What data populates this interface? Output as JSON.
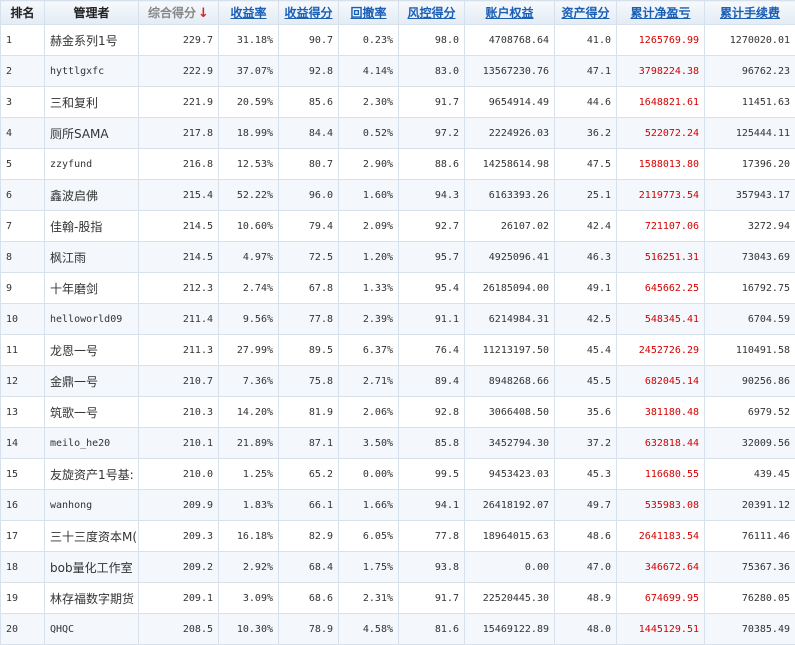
{
  "headers": {
    "rank": "排名",
    "manager": "管理者",
    "total": "综合得分",
    "sort_arrow": "↓",
    "ret": "收益率",
    "ret_score": "收益得分",
    "drawdown": "回撤率",
    "risk": "风控得分",
    "equity": "账户权益",
    "asset_score": "资产得分",
    "pnl": "累计净盈亏",
    "fee": "累计手续费"
  },
  "colors": {
    "link": "#1b5fb5",
    "pnl": "#d40000",
    "sort_arrow": "#e02020"
  },
  "rows": [
    {
      "rank": "1",
      "manager": "赫金系列1号",
      "total": "229.7",
      "ret": "31.18%",
      "ret_score": "90.7",
      "drawdown": "0.23%",
      "risk": "98.0",
      "equity": "4708768.64",
      "asset_score": "41.0",
      "pnl": "1265769.99",
      "fee": "1270020.01"
    },
    {
      "rank": "2",
      "manager": "hyttlgxfc",
      "total": "222.9",
      "ret": "37.07%",
      "ret_score": "92.8",
      "drawdown": "4.14%",
      "risk": "83.0",
      "equity": "13567230.76",
      "asset_score": "47.1",
      "pnl": "3798224.38",
      "fee": "96762.23"
    },
    {
      "rank": "3",
      "manager": "三和复利",
      "total": "221.9",
      "ret": "20.59%",
      "ret_score": "85.6",
      "drawdown": "2.30%",
      "risk": "91.7",
      "equity": "9654914.49",
      "asset_score": "44.6",
      "pnl": "1648821.61",
      "fee": "11451.63"
    },
    {
      "rank": "4",
      "manager": "厕所SAMA",
      "total": "217.8",
      "ret": "18.99%",
      "ret_score": "84.4",
      "drawdown": "0.52%",
      "risk": "97.2",
      "equity": "2224926.03",
      "asset_score": "36.2",
      "pnl": "522072.24",
      "fee": "125444.11"
    },
    {
      "rank": "5",
      "manager": "zzyfund",
      "total": "216.8",
      "ret": "12.53%",
      "ret_score": "80.7",
      "drawdown": "2.90%",
      "risk": "88.6",
      "equity": "14258614.98",
      "asset_score": "47.5",
      "pnl": "1588013.80",
      "fee": "17396.20"
    },
    {
      "rank": "6",
      "manager": "鑫波启佛",
      "total": "215.4",
      "ret": "52.22%",
      "ret_score": "96.0",
      "drawdown": "1.60%",
      "risk": "94.3",
      "equity": "6163393.26",
      "asset_score": "25.1",
      "pnl": "2119773.54",
      "fee": "357943.17"
    },
    {
      "rank": "7",
      "manager": "佳翰-股指",
      "total": "214.5",
      "ret": "10.60%",
      "ret_score": "79.4",
      "drawdown": "2.09%",
      "risk": "92.7",
      "equity": "26107.02",
      "asset_score": "42.4",
      "pnl": "721107.06",
      "fee": "3272.94"
    },
    {
      "rank": "8",
      "manager": "枫江雨",
      "total": "214.5",
      "ret": "4.97%",
      "ret_score": "72.5",
      "drawdown": "1.20%",
      "risk": "95.7",
      "equity": "4925096.41",
      "asset_score": "46.3",
      "pnl": "516251.31",
      "fee": "73043.69"
    },
    {
      "rank": "9",
      "manager": "十年磨剑",
      "total": "212.3",
      "ret": "2.74%",
      "ret_score": "67.8",
      "drawdown": "1.33%",
      "risk": "95.4",
      "equity": "26185094.00",
      "asset_score": "49.1",
      "pnl": "645662.25",
      "fee": "16792.75"
    },
    {
      "rank": "10",
      "manager": "helloworld09",
      "total": "211.4",
      "ret": "9.56%",
      "ret_score": "77.8",
      "drawdown": "2.39%",
      "risk": "91.1",
      "equity": "6214984.31",
      "asset_score": "42.5",
      "pnl": "548345.41",
      "fee": "6704.59"
    },
    {
      "rank": "11",
      "manager": "龙恩一号",
      "total": "211.3",
      "ret": "27.99%",
      "ret_score": "89.5",
      "drawdown": "6.37%",
      "risk": "76.4",
      "equity": "11213197.50",
      "asset_score": "45.4",
      "pnl": "2452726.29",
      "fee": "110491.58"
    },
    {
      "rank": "12",
      "manager": "金鼎一号",
      "total": "210.7",
      "ret": "7.36%",
      "ret_score": "75.8",
      "drawdown": "2.71%",
      "risk": "89.4",
      "equity": "8948268.66",
      "asset_score": "45.5",
      "pnl": "682045.14",
      "fee": "90256.86"
    },
    {
      "rank": "13",
      "manager": "筑歌一号",
      "total": "210.3",
      "ret": "14.20%",
      "ret_score": "81.9",
      "drawdown": "2.06%",
      "risk": "92.8",
      "equity": "3066408.50",
      "asset_score": "35.6",
      "pnl": "381180.48",
      "fee": "6979.52"
    },
    {
      "rank": "14",
      "manager": "meilo_he20",
      "total": "210.1",
      "ret": "21.89%",
      "ret_score": "87.1",
      "drawdown": "3.50%",
      "risk": "85.8",
      "equity": "3452794.30",
      "asset_score": "37.2",
      "pnl": "632818.44",
      "fee": "32009.56"
    },
    {
      "rank": "15",
      "manager": "友旋资产1号基:",
      "total": "210.0",
      "ret": "1.25%",
      "ret_score": "65.2",
      "drawdown": "0.00%",
      "risk": "99.5",
      "equity": "9453423.03",
      "asset_score": "45.3",
      "pnl": "116680.55",
      "fee": "439.45"
    },
    {
      "rank": "16",
      "manager": "wanhong",
      "total": "209.9",
      "ret": "1.83%",
      "ret_score": "66.1",
      "drawdown": "1.66%",
      "risk": "94.1",
      "equity": "26418192.07",
      "asset_score": "49.7",
      "pnl": "535983.08",
      "fee": "20391.12"
    },
    {
      "rank": "17",
      "manager": "三十三度资本M(",
      "total": "209.3",
      "ret": "16.18%",
      "ret_score": "82.9",
      "drawdown": "6.05%",
      "risk": "77.8",
      "equity": "18964015.63",
      "asset_score": "48.6",
      "pnl": "2641183.54",
      "fee": "76111.46"
    },
    {
      "rank": "18",
      "manager": "bob量化工作室",
      "total": "209.2",
      "ret": "2.92%",
      "ret_score": "68.4",
      "drawdown": "1.75%",
      "risk": "93.8",
      "equity": "0.00",
      "asset_score": "47.0",
      "pnl": "346672.64",
      "fee": "75367.36"
    },
    {
      "rank": "19",
      "manager": "林存福数字期货",
      "total": "209.1",
      "ret": "3.09%",
      "ret_score": "68.6",
      "drawdown": "2.31%",
      "risk": "91.7",
      "equity": "22520445.30",
      "asset_score": "48.9",
      "pnl": "674699.95",
      "fee": "76280.05"
    },
    {
      "rank": "20",
      "manager": "QHQC",
      "total": "208.5",
      "ret": "10.30%",
      "ret_score": "78.9",
      "drawdown": "4.58%",
      "risk": "81.6",
      "equity": "15469122.89",
      "asset_score": "48.0",
      "pnl": "1445129.51",
      "fee": "70385.49"
    }
  ]
}
